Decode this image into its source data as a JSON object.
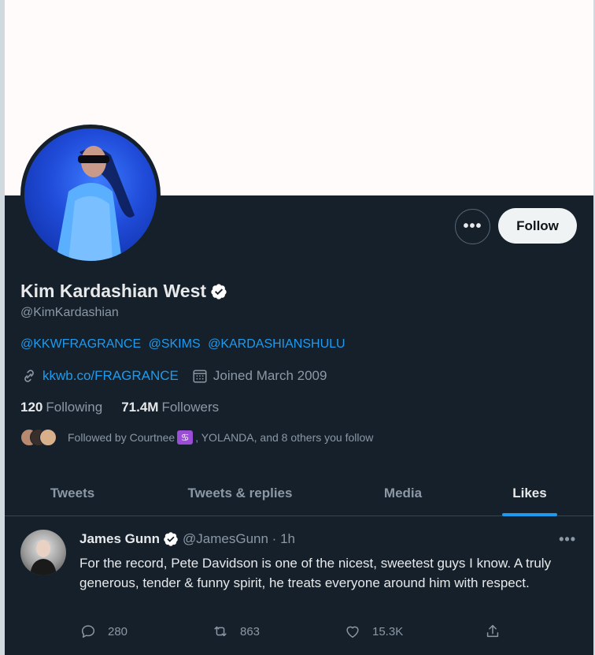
{
  "profile": {
    "name": "Kim Kardashian West",
    "handle": "@KimKardashian",
    "bio_links": [
      "@KKWFRAGRANCE",
      "@SKIMS",
      "@KARDASHIANSHULU"
    ],
    "website": "kkwb.co/FRAGRANCE",
    "joined": "Joined March 2009",
    "following_count": "120",
    "following_label": "Following",
    "followers_count": "71.4M",
    "followers_label": "Followers",
    "followed_by_prefix": "Followed by Courtnee",
    "followed_by_suffix": ", YOLANDA, and 8 others you follow"
  },
  "buttons": {
    "more_label": "•••",
    "follow_label": "Follow"
  },
  "tabs": [
    {
      "label": "Tweets"
    },
    {
      "label": "Tweets & replies"
    },
    {
      "label": "Media"
    },
    {
      "label": "Likes",
      "active": true
    }
  ],
  "tweet": {
    "author_name": "James Gunn",
    "author_handle": "@JamesGunn · 1h",
    "text": "For the record, Pete Davidson is one of the nicest, sweetest guys I know. A truly generous, tender & funny spirit, he treats everyone around him with respect.",
    "more_label": "•••",
    "reply_count": "280",
    "retweet_count": "863",
    "like_count": "15.3K"
  },
  "icons": {
    "verified": "verified-badge-icon",
    "link": "link-icon",
    "calendar": "calendar-icon",
    "reply": "reply-icon",
    "retweet": "retweet-icon",
    "like": "heart-icon",
    "share": "share-icon"
  },
  "colors": {
    "background": "#15202b",
    "accent": "#1d9bf0",
    "banner": "#fffbfb",
    "muted_text": "#8b98a5"
  }
}
